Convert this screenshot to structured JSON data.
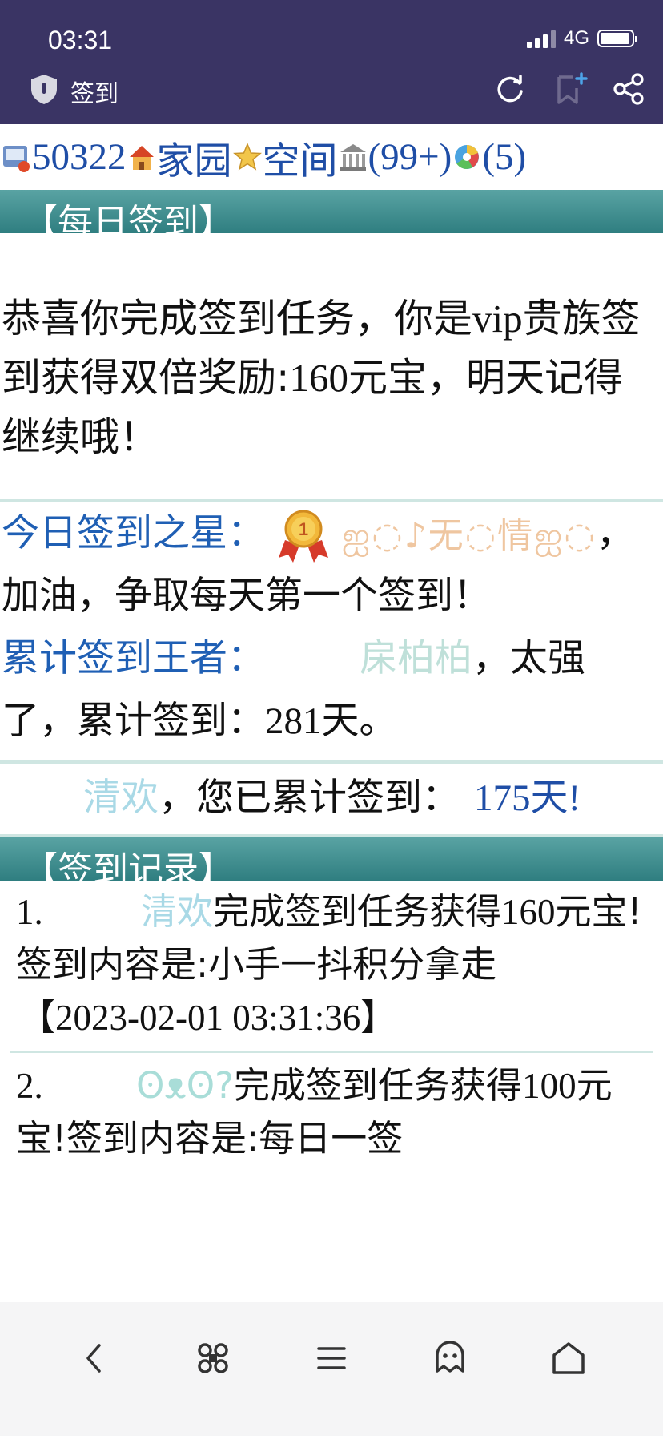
{
  "status_bar": {
    "time": "03:31",
    "network": "4G"
  },
  "title_bar": {
    "title": "签到"
  },
  "nav": {
    "user_id": "50322",
    "home_label": "家园",
    "space_label": "空间",
    "messages_count": "(99+)",
    "notifications_count": "(5)"
  },
  "section_checkin": {
    "title": "【每日签到】"
  },
  "message": {
    "part1": "恭喜你完成签到任务，你是",
    "vip": "vip",
    "part2": "贵族签到获得双倍奖励:",
    "amount": "160",
    "part3": "元宝，明天记得继续哦！"
  },
  "star": {
    "label": "今日签到之星：",
    "name_deco": "ஐ◌♪无◌情ஐ◌",
    "suffix": "，",
    "cheer": "加油，争取每天第一个签到！"
  },
  "king": {
    "label": "累计签到王者：",
    "name": "㦿柏柏",
    "suffix": "，太强",
    "line2_a": "了，累计签到：",
    "days": "281",
    "line2_b": "天。"
  },
  "user_status": {
    "name": "清欢",
    "text": "，您已累计签到：",
    "days": "175天!"
  },
  "section_records": {
    "title": "【签到记录】"
  },
  "records": [
    {
      "index": "1.",
      "user": "清欢",
      "text_a": "完成签到任务获得",
      "amount": "160",
      "text_b": "元宝!签到内容是:小手一抖积分拿走",
      "time": "【2023-02-01 03:31:36】"
    },
    {
      "index": "2.",
      "user": "ʘᴥʘ?",
      "text_a": "完成签到任务获得",
      "amount": "100",
      "text_b": "元宝!签到内容是:每日一签"
    }
  ],
  "colors": {
    "title_bar_bg": "#3a3464",
    "section_bar": "#2f7e80",
    "link_blue": "#1f4ea6",
    "divider": "#cfe6e2"
  },
  "icons": {
    "status": [
      "signal-icon",
      "battery-icon"
    ],
    "title_bar": [
      "shield-icon",
      "refresh-icon",
      "bookmark-add-icon",
      "share-icon"
    ],
    "bottom_bar": [
      "back-icon",
      "command-icon",
      "menu-icon",
      "ghost-icon",
      "home-icon"
    ]
  }
}
